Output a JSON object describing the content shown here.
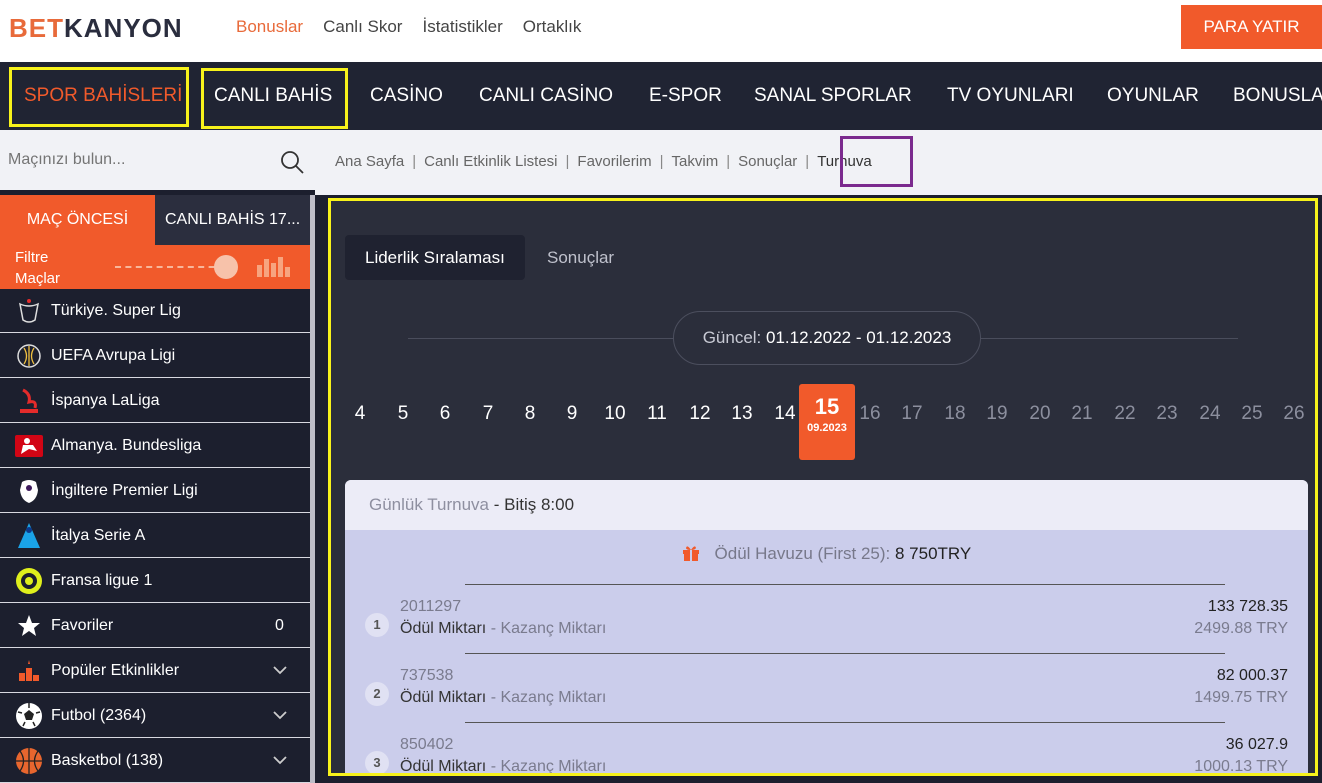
{
  "brand": {
    "part1": "BET",
    "part2": "KANYON"
  },
  "topnav": [
    "Bonuslar",
    "Canlı Skor",
    "İstatistikler",
    "Ortaklık"
  ],
  "deposit_label": "PARA YATIR",
  "mainnav": [
    "SPOR BAHİSLERİ",
    "CANLI BAHİS",
    "CASİNO",
    "CANLI CASİNO",
    "E-SPOR",
    "SANAL SPORLAR",
    "TV OYUNLARI",
    "OYUNLAR",
    "BONUSLAR"
  ],
  "search": {
    "placeholder": "Maçınızı bulun..."
  },
  "breadcrumb": [
    "Ana Sayfa",
    "Canlı Etkinlik Listesi",
    "Favorilerim",
    "Takvim",
    "Sonuçlar",
    "Turnuva"
  ],
  "sidebar": {
    "tab_pre": "MAÇ ÖNCESİ",
    "tab_live": "CANLI BAHİS  17...",
    "filter_label": "Filtre Maçlar",
    "items": [
      {
        "label": "Türkiye. Super Lig",
        "icon": "super-lig-icon"
      },
      {
        "label": "UEFA Avrupa Ligi",
        "icon": "europa-league-icon"
      },
      {
        "label": "İspanya LaLiga",
        "icon": "laliga-icon"
      },
      {
        "label": "Almanya. Bundesliga",
        "icon": "bundesliga-icon"
      },
      {
        "label": "İngiltere Premier Ligi",
        "icon": "premier-league-icon"
      },
      {
        "label": "İtalya Serie A",
        "icon": "serie-a-icon"
      },
      {
        "label": "Fransa ligue 1",
        "icon": "ligue1-icon"
      },
      {
        "label": "Favoriler",
        "icon": "star-icon",
        "count": "0"
      },
      {
        "label": "Popüler Etkinlikler",
        "icon": "podium-icon",
        "chevron": true
      },
      {
        "label": "Futbol (2364)",
        "icon": "football-icon",
        "chevron": true
      },
      {
        "label": "Basketbol (138)",
        "icon": "basketball-icon",
        "chevron": true
      }
    ]
  },
  "tabs": {
    "leaderboard": "Liderlik Sıralaması",
    "results": "Sonuçlar"
  },
  "period": {
    "label": "Güncel:",
    "value": "01.12.2022 - 01.12.2023"
  },
  "days": [
    "4",
    "5",
    "6",
    "7",
    "8",
    "9",
    "10",
    "11",
    "12",
    "13",
    "14",
    "15",
    "16",
    "17",
    "18",
    "19",
    "20",
    "21",
    "22",
    "23",
    "24",
    "25",
    "26"
  ],
  "active_day": {
    "num": "15",
    "date": "09.2023"
  },
  "card": {
    "title": "Günlük Turnuva",
    "end": "- Bitiş 8:00",
    "prize_label": "Ödül Havuzu (First 25):",
    "prize_value": "8 750TRY",
    "rows": [
      {
        "rank": "1",
        "user": "2011297",
        "label": "Ödül Miktarı",
        "sub": "- Kazanç Miktarı",
        "points": "133 728.35",
        "prize": "2499.88 TRY"
      },
      {
        "rank": "2",
        "user": "737538",
        "label": "Ödül Miktarı",
        "sub": "- Kazanç Miktarı",
        "points": "82 000.37",
        "prize": "1499.75 TRY"
      },
      {
        "rank": "3",
        "user": "850402",
        "label": "Ödül Miktarı",
        "sub": "- Kazanç Miktarı",
        "points": "36 027.9",
        "prize": "1000.13 TRY"
      }
    ]
  },
  "colors": {
    "accent": "#f15a2b",
    "nav_bg": "#202433",
    "highlight_yellow": "#f7f21b",
    "highlight_purple": "#7b2a8e"
  }
}
